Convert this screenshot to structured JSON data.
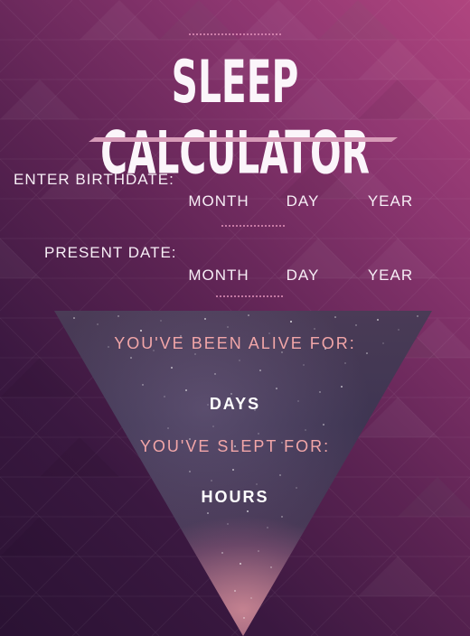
{
  "title": "SLEEP CALCULATOR",
  "birthdate": {
    "label": "ENTER BIRTHDATE:",
    "month_placeholder": "MONTH",
    "day_placeholder": "DAY",
    "year_placeholder": "YEAR"
  },
  "present_date": {
    "label": "PRESENT DATE:",
    "month_placeholder": "MONTH",
    "day_placeholder": "DAY",
    "year_placeholder": "YEAR"
  },
  "results": {
    "alive_label": "YOU'VE BEEN ALIVE FOR:",
    "alive_unit": "DAYS",
    "slept_label": "YOU'VE SLEPT FOR:",
    "slept_unit": "HOURS"
  },
  "colors": {
    "accent": "#f2a6a8",
    "title_underline": "#d79bb8",
    "background_top": "#b0457f",
    "background_bottom": "#2a1233"
  }
}
